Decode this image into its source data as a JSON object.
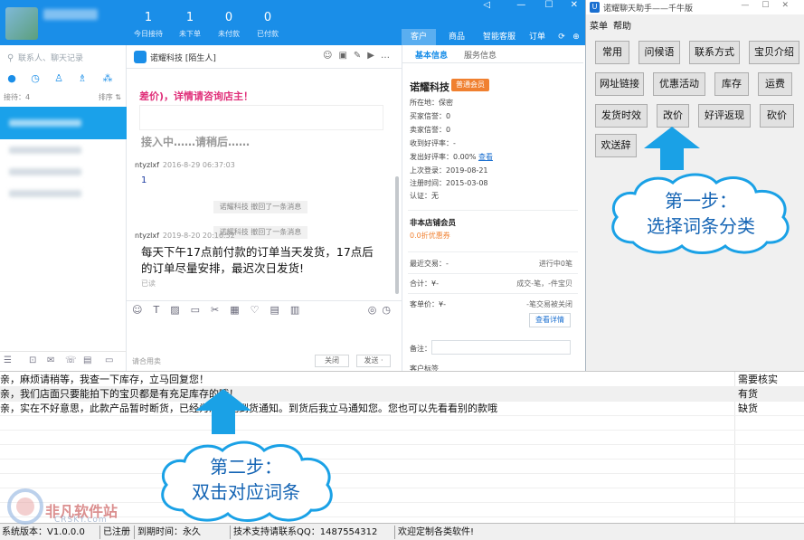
{
  "qn": {
    "stats": [
      {
        "num": "1",
        "label": "今日接待"
      },
      {
        "num": "1",
        "label": "未下单"
      },
      {
        "num": "0",
        "label": "未付款"
      },
      {
        "num": "0",
        "label": "已付款"
      }
    ],
    "top_tabs": [
      "客户",
      "商品",
      "智能客服",
      "订单"
    ],
    "search_placeholder": "联系人、聊天记录",
    "sort_left": "接待：4",
    "sort_right": "排序 ⇅",
    "chat_title": "诺耀科技 [陌生人]",
    "msg_pink": "差价)，详情请咨询店主！",
    "msg_wait": "接入中……请稍后……",
    "msg1_sender": "ntyzlxf",
    "msg1_time": "2016-8-29 06:37:03",
    "msg1_text": "1",
    "recall_1": "诺耀科技 撤回了一条消息",
    "recall_2": "诺耀科技 撤回了一条消息",
    "msg2_sender": "ntyzlxf",
    "msg2_time": "2019-8-20 20:16:52",
    "msg2_text": "每天下午17点前付款的订单当天发货，17点后的订单尽量安排，最迟次日发货!",
    "msg2_status": "已读",
    "footer_hint": "请合用卖",
    "btn_close": "关闭",
    "btn_send": "发送 ·",
    "info": {
      "tabs": [
        "基本信息",
        "服务信息"
      ],
      "shop_name": "诺耀科技",
      "badge": "普通会员",
      "rows": [
        {
          "k": "所在地：",
          "v": "保密"
        },
        {
          "k": "买家信誉：",
          "v": "0"
        },
        {
          "k": "卖家信誉：",
          "v": "0"
        },
        {
          "k": "收到好评率：",
          "v": "-"
        },
        {
          "k": "发出好评率：",
          "v": "0.00%"
        },
        {
          "k": "上次登录：",
          "v": "2019-08-21"
        },
        {
          "k": "注册时间：",
          "v": "2015-03-08"
        },
        {
          "k": "认证：",
          "v": "无"
        }
      ],
      "view_link": "查看",
      "member_title": "非本店铺会员",
      "discount": "0.0折优惠券",
      "recent_label": "最近交易：-",
      "recent_right": "进行中0笔",
      "total_label": "合计：¥-",
      "total_right": "成交-笔，-件宝贝",
      "avg_label": "客单价：¥-",
      "avg_right": "-笔交易被关闭",
      "detail_btn": "查看详情",
      "note_label": "备注：",
      "more_label": "客户标签"
    }
  },
  "helper": {
    "title": "诺耀聊天助手——千牛版",
    "menu": [
      "菜单",
      "帮助"
    ],
    "buttons": [
      "常用",
      "问候语",
      "联系方式",
      "宝贝介绍",
      "网址链接",
      "优惠活动",
      "库存",
      "运费",
      "发货时效",
      "改价",
      "好评返现",
      "砍价",
      "欢送辞"
    ]
  },
  "phrases": [
    {
      "text": "亲，麻烦请稍等，我查一下库存，立马回复您！",
      "note": "需要核实"
    },
    {
      "text": "亲，我们店面只要能拍下的宝贝都是有充足库存的哦！",
      "note": "有货"
    },
    {
      "text": "亲，实在不好意思，此款产品暂时断货，已经为您登记到货通知。到货后我立马通知您。您也可以先看看别的款哦",
      "note": "缺货"
    }
  ],
  "status": {
    "version": "系统版本：V1.0.0.0",
    "registered": "已注册",
    "expire": "到期时间：永久",
    "support": "技术支持请联系QQ：1487554312",
    "welcome": "欢迎定制各类软件!"
  },
  "overlay": {
    "step1_line1": "第一步：",
    "step1_line2": "选择词条分类",
    "step2_line1": "第二步：",
    "step2_line2": "双击对应词条",
    "watermark": "非凡软件站",
    "watermark_sub": "CRSKY.com"
  },
  "colors": {
    "qn_blue": "#1a8ee8",
    "arrow_blue": "#1aa1e6",
    "cloud_text": "#1464b4",
    "pink": "#e0307a",
    "orange": "#f08030"
  }
}
